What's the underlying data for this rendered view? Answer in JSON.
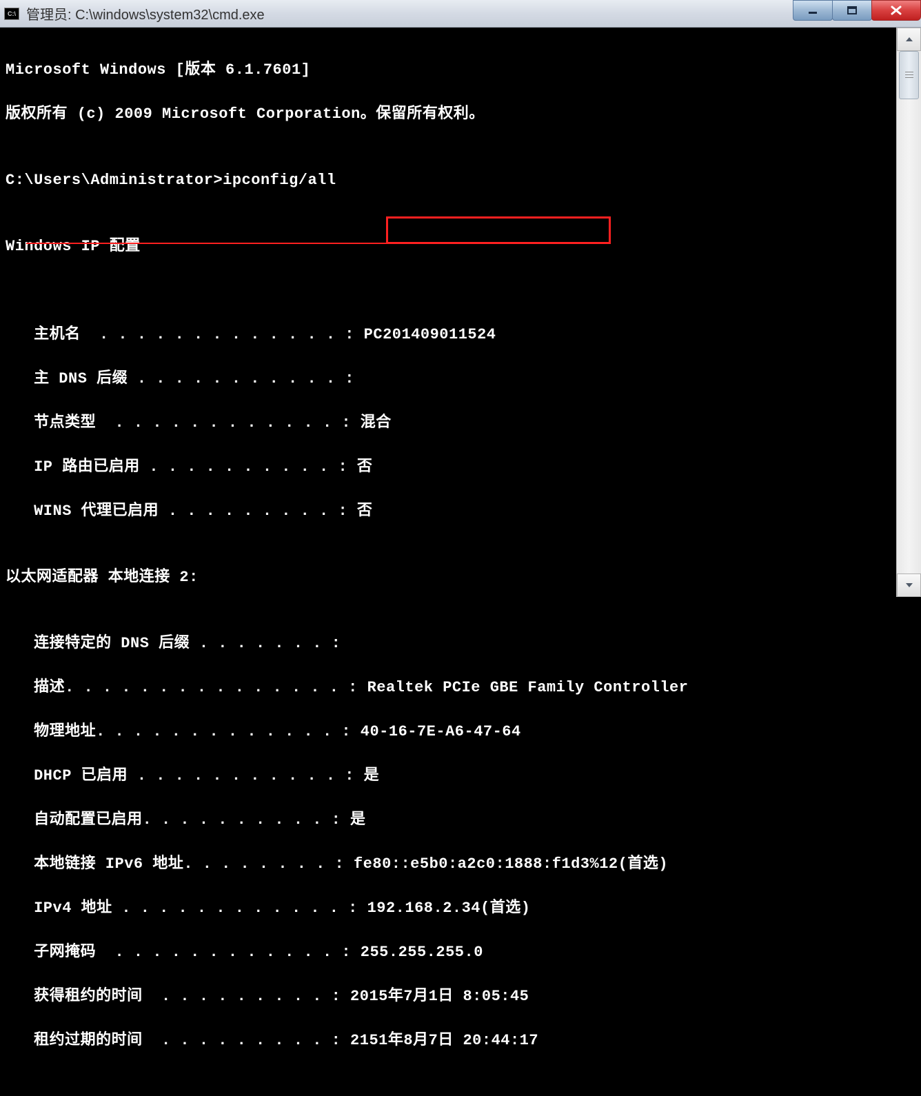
{
  "window": {
    "icon_text": "C:\\",
    "title": "管理员: C:\\windows\\system32\\cmd.exe"
  },
  "lines": {
    "l1": "Microsoft Windows [版本 6.1.7601]",
    "l2": "版权所有 (c) 2009 Microsoft Corporation。保留所有权利。",
    "l3": "",
    "l4": "C:\\Users\\Administrator>ipconfig/all",
    "l5": "",
    "l6": "Windows IP 配置",
    "l7": "",
    "l8": "",
    "l9": "   主机名  . . . . . . . . . . . . . : PC201409011524",
    "l10": "   主 DNS 后缀 . . . . . . . . . . . :",
    "l11": "   节点类型  . . . . . . . . . . . . : 混合",
    "l12": "   IP 路由已启用 . . . . . . . . . . : 否",
    "l13": "   WINS 代理已启用 . . . . . . . . . : 否",
    "l14": "",
    "l15": "以太网适配器 本地连接 2:",
    "l16": "",
    "l17": "   连接特定的 DNS 后缀 . . . . . . . :",
    "l18": "   描述. . . . . . . . . . . . . . . : Realtek PCIe GBE Family Controller",
    "l19": "   物理地址. . . . . . . . . . . . . : 40-16-7E-A6-47-64",
    "l20": "   DHCP 已启用 . . . . . . . . . . . : 是",
    "l21": "   自动配置已启用. . . . . . . . . . : 是",
    "l22": "   本地链接 IPv6 地址. . . . . . . . : fe80::e5b0:a2c0:1888:f1d3%12(首选)",
    "l23": "   IPv4 地址 . . . . . . . . . . . . : 192.168.2.34(首选)",
    "l24": "   子网掩码  . . . . . . . . . . . . : 255.255.255.0",
    "l25": "   获得租约的时间  . . . . . . . . . : 2015年7月1日 8:05:45",
    "l26": "   租约过期的时间  . . . . . . . . . : 2151年8月7日 20:44:17"
  },
  "ipconfig": {
    "hostname": "PC201409011524",
    "primary_dns_suffix": "",
    "node_type": "混合",
    "ip_routing_enabled": "否",
    "wins_proxy_enabled": "否",
    "adapter_name": "以太网适配器 本地连接 2",
    "connection_dns_suffix": "",
    "description": "Realtek PCIe GBE Family Controller",
    "physical_address": "40-16-7E-A6-47-64",
    "dhcp_enabled": "是",
    "auto_config_enabled": "是",
    "link_local_ipv6": "fe80::e5b0:a2c0:1888:f1d3%12(首选)",
    "ipv4_address": "192.168.2.34(首选)",
    "subnet_mask": "255.255.255.0",
    "lease_obtained": "2015年7月1日 8:05:45",
    "lease_expires": "2151年8月7日 20:44:17"
  }
}
